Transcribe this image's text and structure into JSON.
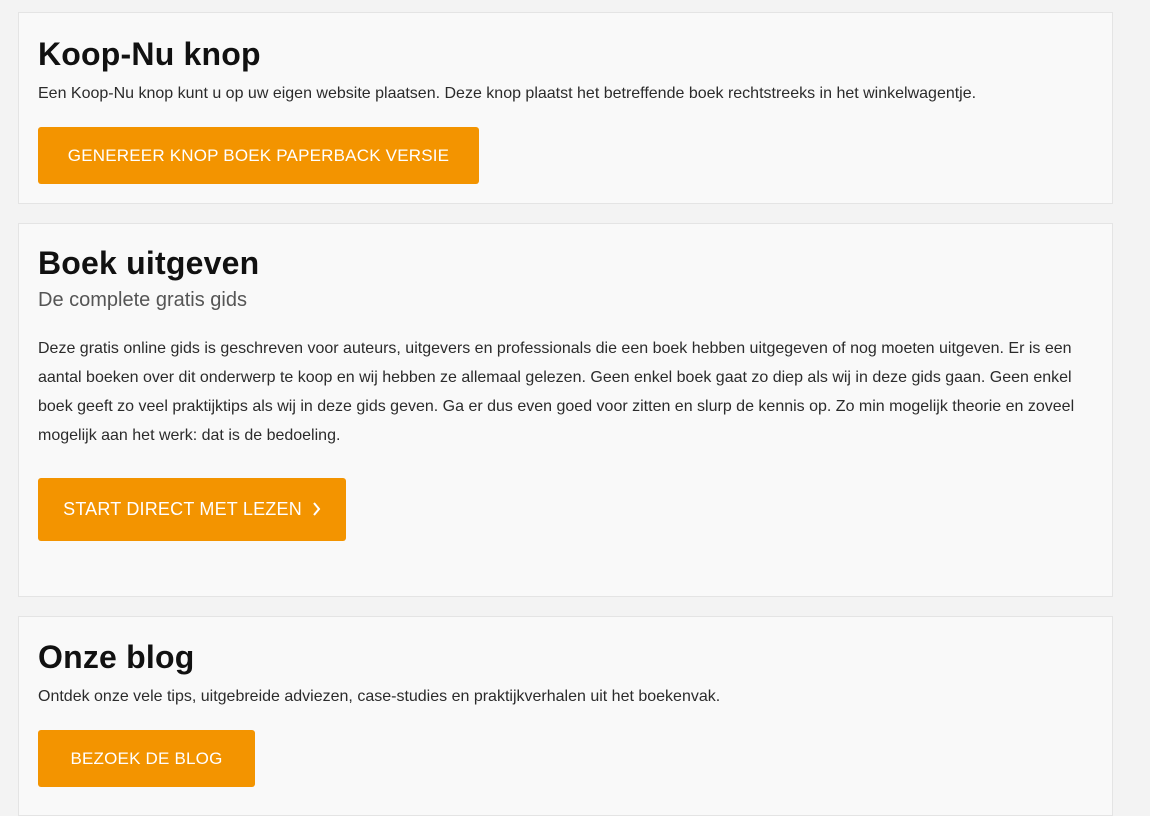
{
  "sections": {
    "buy_button": {
      "title": "Koop-Nu knop",
      "text": "Een Koop-Nu knop kunt u op uw eigen website plaatsen. Deze knop plaatst het betreffende boek rechtstreeks in het winkelwagentje.",
      "button_label": "GENEREER KNOP BOEK PAPERBACK VERSIE"
    },
    "publish": {
      "title": "Boek uitgeven",
      "subtitle": "De complete gratis gids",
      "paragraph": "Deze gratis online gids is geschreven voor auteurs, uitgevers en professionals die een boek hebben uitgegeven of nog moeten uitgeven. Er is een aantal boeken over dit onderwerp te koop en wij hebben ze allemaal gelezen. Geen enkel boek gaat zo diep als wij in deze gids gaan. Geen enkel boek geeft zo veel praktijktips als wij in deze gids geven. Ga er dus even goed voor zitten en slurp de kennis op. Zo min mogelijk theorie en zoveel mogelijk aan het werk: dat is de bedoeling.",
      "button_label": "START DIRECT MET LEZEN",
      "button_icon": "chevron-right-icon"
    },
    "blog": {
      "title": "Onze blog",
      "text": "Ontdek onze vele tips, uitgebreide adviezen, case-studies en praktijkverhalen uit het boekenvak.",
      "button_label": "BEZOEK DE BLOG"
    }
  },
  "colors": {
    "accent": "#f39400",
    "card_background": "#f9f9f9",
    "page_background": "#f3f3f3"
  }
}
